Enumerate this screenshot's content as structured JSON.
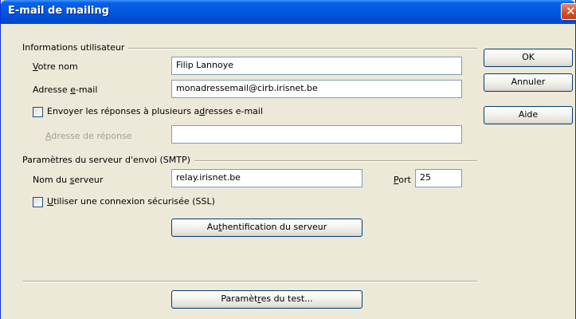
{
  "window": {
    "title": "E-mail de mailing",
    "close_glyph": "✕"
  },
  "user_info": {
    "section_title": "Informations utilisateur",
    "name_label_key": "V",
    "name_label_rest": "otre nom",
    "name_value": "Filip Lannoye",
    "email_label_pre": "Adresse ",
    "email_label_key": "e",
    "email_label_post": "-mail",
    "email_value": "monadressemail@cirb.irisnet.be",
    "reply_checkbox_pre": "Envoyer les réponses à plusieurs a",
    "reply_checkbox_key": "d",
    "reply_checkbox_post": "resses e-mail",
    "reply_checked": false,
    "reply_label_key": "A",
    "reply_label_rest": "dresse de réponse",
    "reply_value": ""
  },
  "smtp": {
    "section_title": "Paramètres du serveur d'envoi (SMTP)",
    "server_label_pre": "Nom du ",
    "server_label_key": "s",
    "server_label_post": "erveur",
    "server_value": "relay.irisnet.be",
    "port_label_key": "P",
    "port_label_rest": "ort",
    "port_value": "25",
    "ssl_label_key": "U",
    "ssl_label_rest": "tiliser une connexion sécurisée (SSL)",
    "ssl_checked": false,
    "auth_button_pre": "Au",
    "auth_button_key": "t",
    "auth_button_post": "hentification du serveur"
  },
  "test_button": {
    "pre": "Paramèt",
    "key": "r",
    "post": "es du test..."
  },
  "buttons": {
    "ok": "OK",
    "cancel": "Annuler",
    "help": "Aide"
  },
  "icons": {
    "close": "close-icon",
    "checkbox": "checkbox-icon"
  },
  "colors": {
    "titlebar": "#0458df",
    "dialog_bg": "#ece9d8",
    "input_border": "#7f9db9",
    "button_border": "#003c74",
    "close": "#d5502b"
  }
}
